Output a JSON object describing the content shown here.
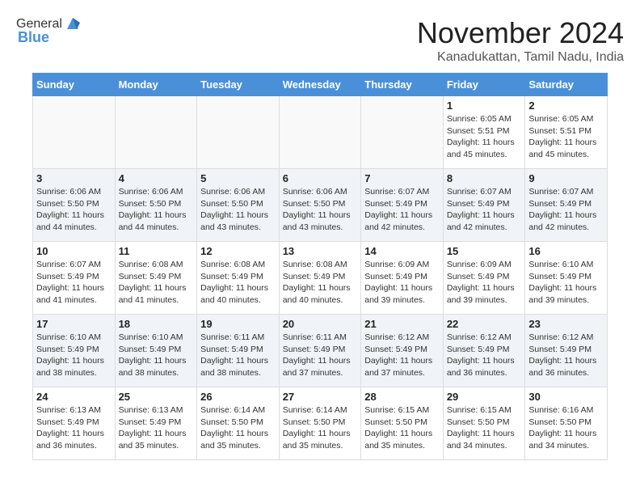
{
  "header": {
    "logo_general": "General",
    "logo_blue": "Blue",
    "month_title": "November 2024",
    "subtitle": "Kanadukattan, Tamil Nadu, India"
  },
  "days_of_week": [
    "Sunday",
    "Monday",
    "Tuesday",
    "Wednesday",
    "Thursday",
    "Friday",
    "Saturday"
  ],
  "weeks": [
    {
      "days": [
        {
          "num": "",
          "info": ""
        },
        {
          "num": "",
          "info": ""
        },
        {
          "num": "",
          "info": ""
        },
        {
          "num": "",
          "info": ""
        },
        {
          "num": "",
          "info": ""
        },
        {
          "num": "1",
          "info": "Sunrise: 6:05 AM\nSunset: 5:51 PM\nDaylight: 11 hours\nand 45 minutes."
        },
        {
          "num": "2",
          "info": "Sunrise: 6:05 AM\nSunset: 5:51 PM\nDaylight: 11 hours\nand 45 minutes."
        }
      ]
    },
    {
      "days": [
        {
          "num": "3",
          "info": "Sunrise: 6:06 AM\nSunset: 5:50 PM\nDaylight: 11 hours\nand 44 minutes."
        },
        {
          "num": "4",
          "info": "Sunrise: 6:06 AM\nSunset: 5:50 PM\nDaylight: 11 hours\nand 44 minutes."
        },
        {
          "num": "5",
          "info": "Sunrise: 6:06 AM\nSunset: 5:50 PM\nDaylight: 11 hours\nand 43 minutes."
        },
        {
          "num": "6",
          "info": "Sunrise: 6:06 AM\nSunset: 5:50 PM\nDaylight: 11 hours\nand 43 minutes."
        },
        {
          "num": "7",
          "info": "Sunrise: 6:07 AM\nSunset: 5:49 PM\nDaylight: 11 hours\nand 42 minutes."
        },
        {
          "num": "8",
          "info": "Sunrise: 6:07 AM\nSunset: 5:49 PM\nDaylight: 11 hours\nand 42 minutes."
        },
        {
          "num": "9",
          "info": "Sunrise: 6:07 AM\nSunset: 5:49 PM\nDaylight: 11 hours\nand 42 minutes."
        }
      ]
    },
    {
      "days": [
        {
          "num": "10",
          "info": "Sunrise: 6:07 AM\nSunset: 5:49 PM\nDaylight: 11 hours\nand 41 minutes."
        },
        {
          "num": "11",
          "info": "Sunrise: 6:08 AM\nSunset: 5:49 PM\nDaylight: 11 hours\nand 41 minutes."
        },
        {
          "num": "12",
          "info": "Sunrise: 6:08 AM\nSunset: 5:49 PM\nDaylight: 11 hours\nand 40 minutes."
        },
        {
          "num": "13",
          "info": "Sunrise: 6:08 AM\nSunset: 5:49 PM\nDaylight: 11 hours\nand 40 minutes."
        },
        {
          "num": "14",
          "info": "Sunrise: 6:09 AM\nSunset: 5:49 PM\nDaylight: 11 hours\nand 39 minutes."
        },
        {
          "num": "15",
          "info": "Sunrise: 6:09 AM\nSunset: 5:49 PM\nDaylight: 11 hours\nand 39 minutes."
        },
        {
          "num": "16",
          "info": "Sunrise: 6:10 AM\nSunset: 5:49 PM\nDaylight: 11 hours\nand 39 minutes."
        }
      ]
    },
    {
      "days": [
        {
          "num": "17",
          "info": "Sunrise: 6:10 AM\nSunset: 5:49 PM\nDaylight: 11 hours\nand 38 minutes."
        },
        {
          "num": "18",
          "info": "Sunrise: 6:10 AM\nSunset: 5:49 PM\nDaylight: 11 hours\nand 38 minutes."
        },
        {
          "num": "19",
          "info": "Sunrise: 6:11 AM\nSunset: 5:49 PM\nDaylight: 11 hours\nand 38 minutes."
        },
        {
          "num": "20",
          "info": "Sunrise: 6:11 AM\nSunset: 5:49 PM\nDaylight: 11 hours\nand 37 minutes."
        },
        {
          "num": "21",
          "info": "Sunrise: 6:12 AM\nSunset: 5:49 PM\nDaylight: 11 hours\nand 37 minutes."
        },
        {
          "num": "22",
          "info": "Sunrise: 6:12 AM\nSunset: 5:49 PM\nDaylight: 11 hours\nand 36 minutes."
        },
        {
          "num": "23",
          "info": "Sunrise: 6:12 AM\nSunset: 5:49 PM\nDaylight: 11 hours\nand 36 minutes."
        }
      ]
    },
    {
      "days": [
        {
          "num": "24",
          "info": "Sunrise: 6:13 AM\nSunset: 5:49 PM\nDaylight: 11 hours\nand 36 minutes."
        },
        {
          "num": "25",
          "info": "Sunrise: 6:13 AM\nSunset: 5:49 PM\nDaylight: 11 hours\nand 35 minutes."
        },
        {
          "num": "26",
          "info": "Sunrise: 6:14 AM\nSunset: 5:50 PM\nDaylight: 11 hours\nand 35 minutes."
        },
        {
          "num": "27",
          "info": "Sunrise: 6:14 AM\nSunset: 5:50 PM\nDaylight: 11 hours\nand 35 minutes."
        },
        {
          "num": "28",
          "info": "Sunrise: 6:15 AM\nSunset: 5:50 PM\nDaylight: 11 hours\nand 35 minutes."
        },
        {
          "num": "29",
          "info": "Sunrise: 6:15 AM\nSunset: 5:50 PM\nDaylight: 11 hours\nand 34 minutes."
        },
        {
          "num": "30",
          "info": "Sunrise: 6:16 AM\nSunset: 5:50 PM\nDaylight: 11 hours\nand 34 minutes."
        }
      ]
    }
  ]
}
